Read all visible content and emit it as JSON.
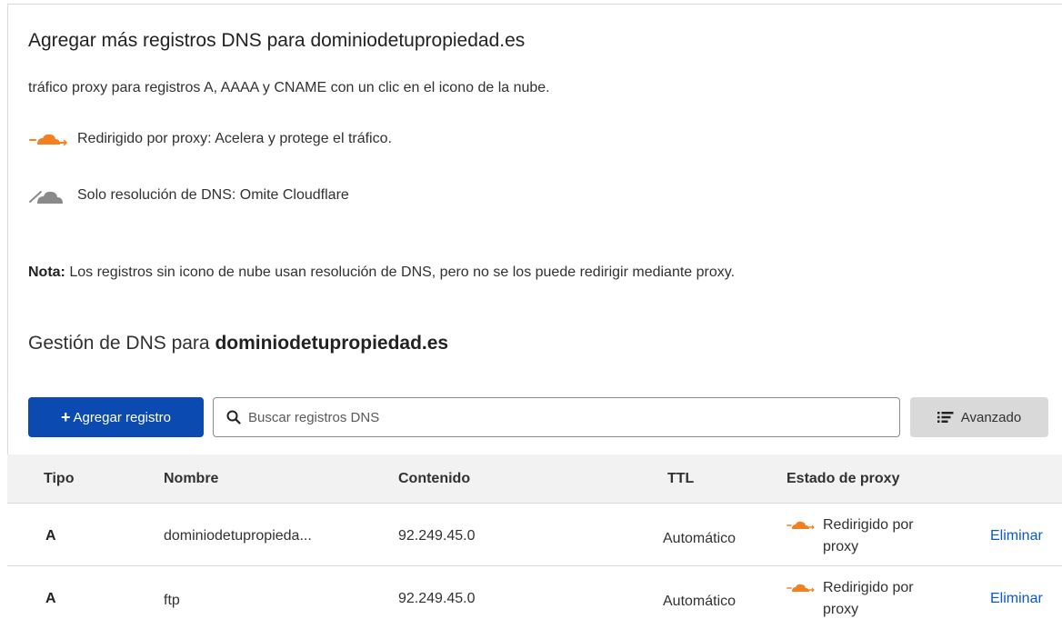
{
  "section1": {
    "title": "Agregar más registros DNS para dominiodetupropiedad.es",
    "description": "tráfico proxy para registros A, AAAA y CNAME con un clic en el icono de la nube.",
    "legend": [
      {
        "icon": "orange-cloud-icon",
        "text": "Redirigido por proxy: Acelera y protege el tráfico."
      },
      {
        "icon": "gray-cloud-icon",
        "text": "Solo resolución de DNS: Omite Cloudflare"
      }
    ],
    "note_label": "Nota:",
    "note_text": " Los registros sin icono de nube usan resolución de DNS, pero no se los puede redirigir mediante proxy."
  },
  "section2": {
    "title_prefix": "Gestión de DNS para ",
    "title_domain": "dominiodetupropiedad.es"
  },
  "toolbar": {
    "add_label": "Agregar registro",
    "search_placeholder": "Buscar registros DNS",
    "advanced_label": "Avanzado"
  },
  "table": {
    "headers": [
      "Tipo",
      "Nombre",
      "Contenido",
      "TTL",
      "Estado de proxy"
    ],
    "rows": [
      {
        "type": "A",
        "name": "dominiodetupropieda...",
        "content": "92.249.45.0",
        "ttl": "Automático",
        "proxy": "Redirigido por proxy",
        "action": "Eliminar"
      },
      {
        "type": "A",
        "name": "ftp",
        "content": "92.249.45.0",
        "ttl": "Automático",
        "proxy": "Redirigido por proxy",
        "action": "Eliminar"
      }
    ]
  },
  "colors": {
    "primary": "#0a4ab1",
    "link": "#0a59c9",
    "proxy_orange": "#f38020",
    "dns_gray": "#8a8a8a"
  }
}
